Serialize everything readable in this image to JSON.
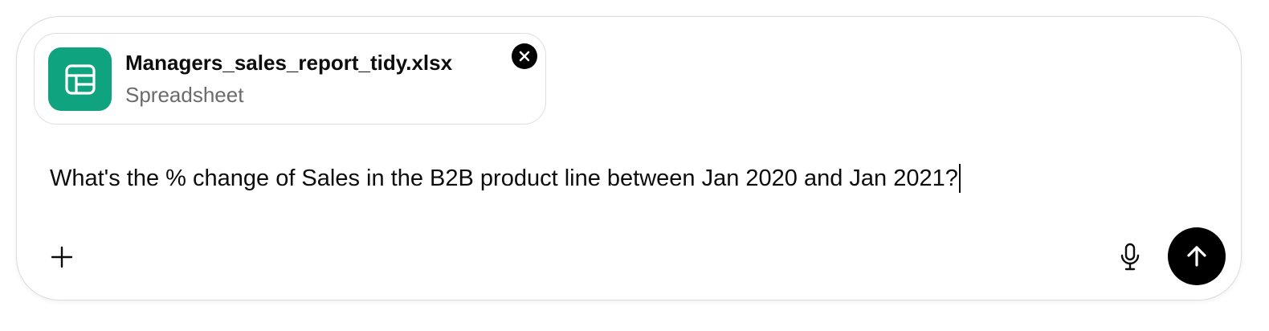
{
  "attachment": {
    "file_name": "Managers_sales_report_tidy.xlsx",
    "file_type": "Spreadsheet",
    "icon": "spreadsheet-icon",
    "icon_color": "#10a37f",
    "remove_icon": "close-icon"
  },
  "composer": {
    "prompt_value": "What's the % change of Sales in the B2B product line between Jan 2020 and Jan 2021?",
    "add_icon": "plus-icon",
    "mic_icon": "microphone-icon",
    "send_icon": "arrow-up-icon"
  }
}
